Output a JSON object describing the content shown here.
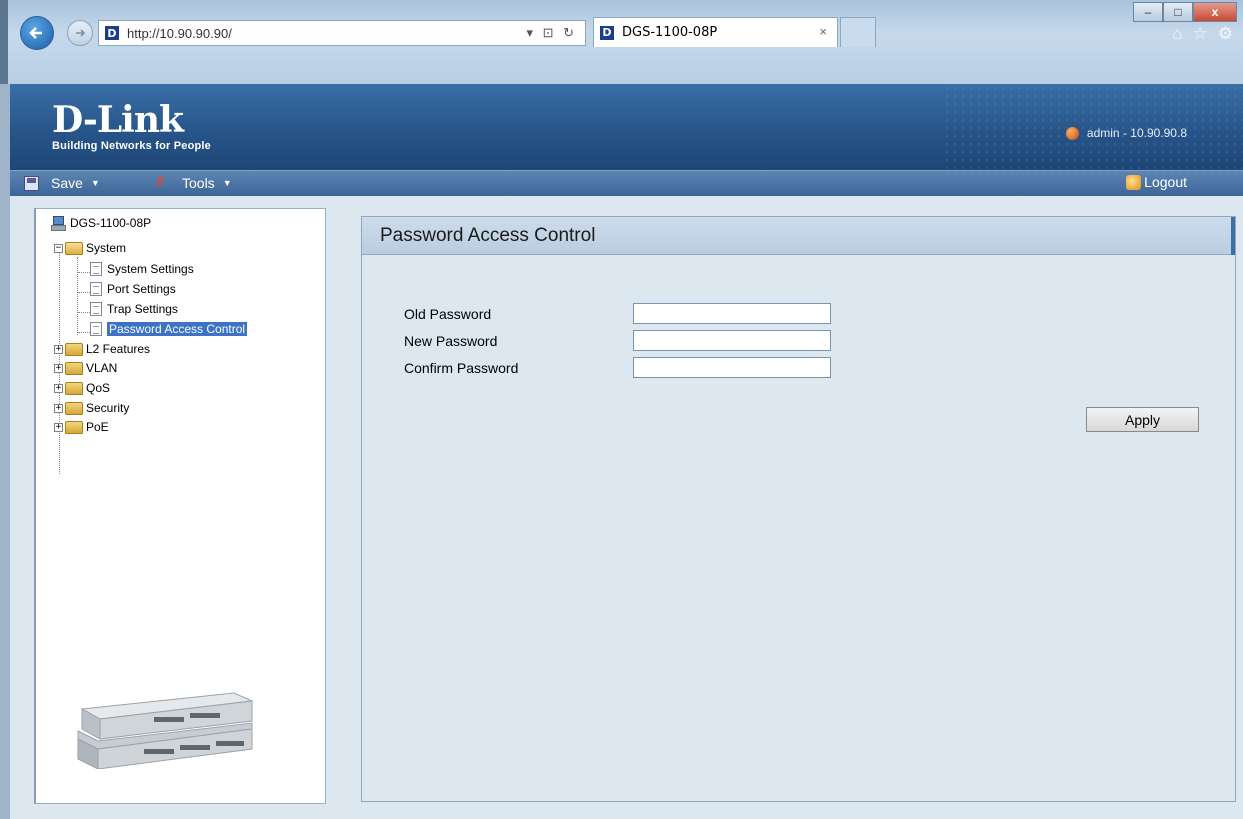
{
  "browser": {
    "url": "http://10.90.90.90/",
    "tab_title": "DGS-1100-08P",
    "favicon_letter": "D",
    "addr_controls": "▾ ⊡ ↻",
    "tab_close": "×",
    "win_minimize": "–",
    "win_maximize": "□",
    "win_close": "x"
  },
  "header": {
    "logo": "D-Link",
    "tagline": "Building Networks for People",
    "user": "admin - 10.90.90.8"
  },
  "toolbar": {
    "save_label": "Save",
    "tools_label": "Tools",
    "logout_label": "Logout"
  },
  "tree": {
    "root": "DGS-1100-08P",
    "system": "System",
    "system_children": [
      "System Settings",
      "Port Settings",
      "Trap Settings",
      "Password Access Control"
    ],
    "folders": [
      "L2 Features",
      "VLAN",
      "QoS",
      "Security",
      "PoE"
    ],
    "expanded_sign": "−",
    "collapsed_sign": "+"
  },
  "content": {
    "title": "Password Access Control",
    "old_password_label": "Old Password",
    "new_password_label": "New Password",
    "confirm_password_label": "Confirm Password",
    "apply_label": "Apply"
  },
  "colors": {
    "header_blue": "#2a5a8f",
    "selection": "#3c73c7",
    "panel_bg": "#dde7f0"
  }
}
